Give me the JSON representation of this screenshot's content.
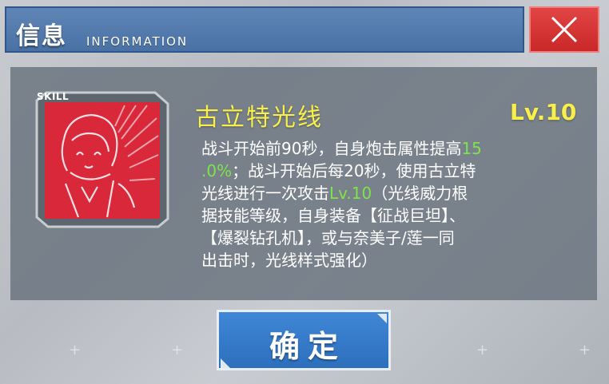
{
  "header": {
    "title": "信息",
    "subtitle": "INFORMATION"
  },
  "skill": {
    "tag": "SKILL",
    "name": "古立特光线",
    "level": "Lv.10",
    "description_lines": [
      [
        {
          "text": "战斗开始前90秒，自身炮击属性提高",
          "hl": false
        },
        {
          "text": "15",
          "hl": true
        }
      ],
      [
        {
          "text": ".0%",
          "hl": true
        },
        {
          "text": "；战斗开始后每20秒，使用古立特",
          "hl": false
        }
      ],
      [
        {
          "text": "光线进行一次攻击",
          "hl": false
        },
        {
          "text": "Lv.10",
          "hl": true
        },
        {
          "text": "（光线威力根",
          "hl": false
        }
      ],
      [
        {
          "text": "据技能等级，自身装备【征战巨坦】、",
          "hl": false
        }
      ],
      [
        {
          "text": "【爆裂钻孔机】，或与奈美子/莲一同",
          "hl": false
        }
      ],
      [
        {
          "text": "出击时，光线样式强化）",
          "hl": false
        }
      ]
    ]
  },
  "buttons": {
    "confirm_label": "确定"
  },
  "colors": {
    "header_blue": "#5f86b6",
    "close_red": "#e24545",
    "skill_name_yellow": "#f8ef4a",
    "highlight_green": "#7fe34a",
    "confirm_blue": "#3f87d6",
    "icon_red": "#d8283a"
  },
  "icons": {
    "close": "close-icon",
    "skill": "skill-portrait-icon"
  }
}
